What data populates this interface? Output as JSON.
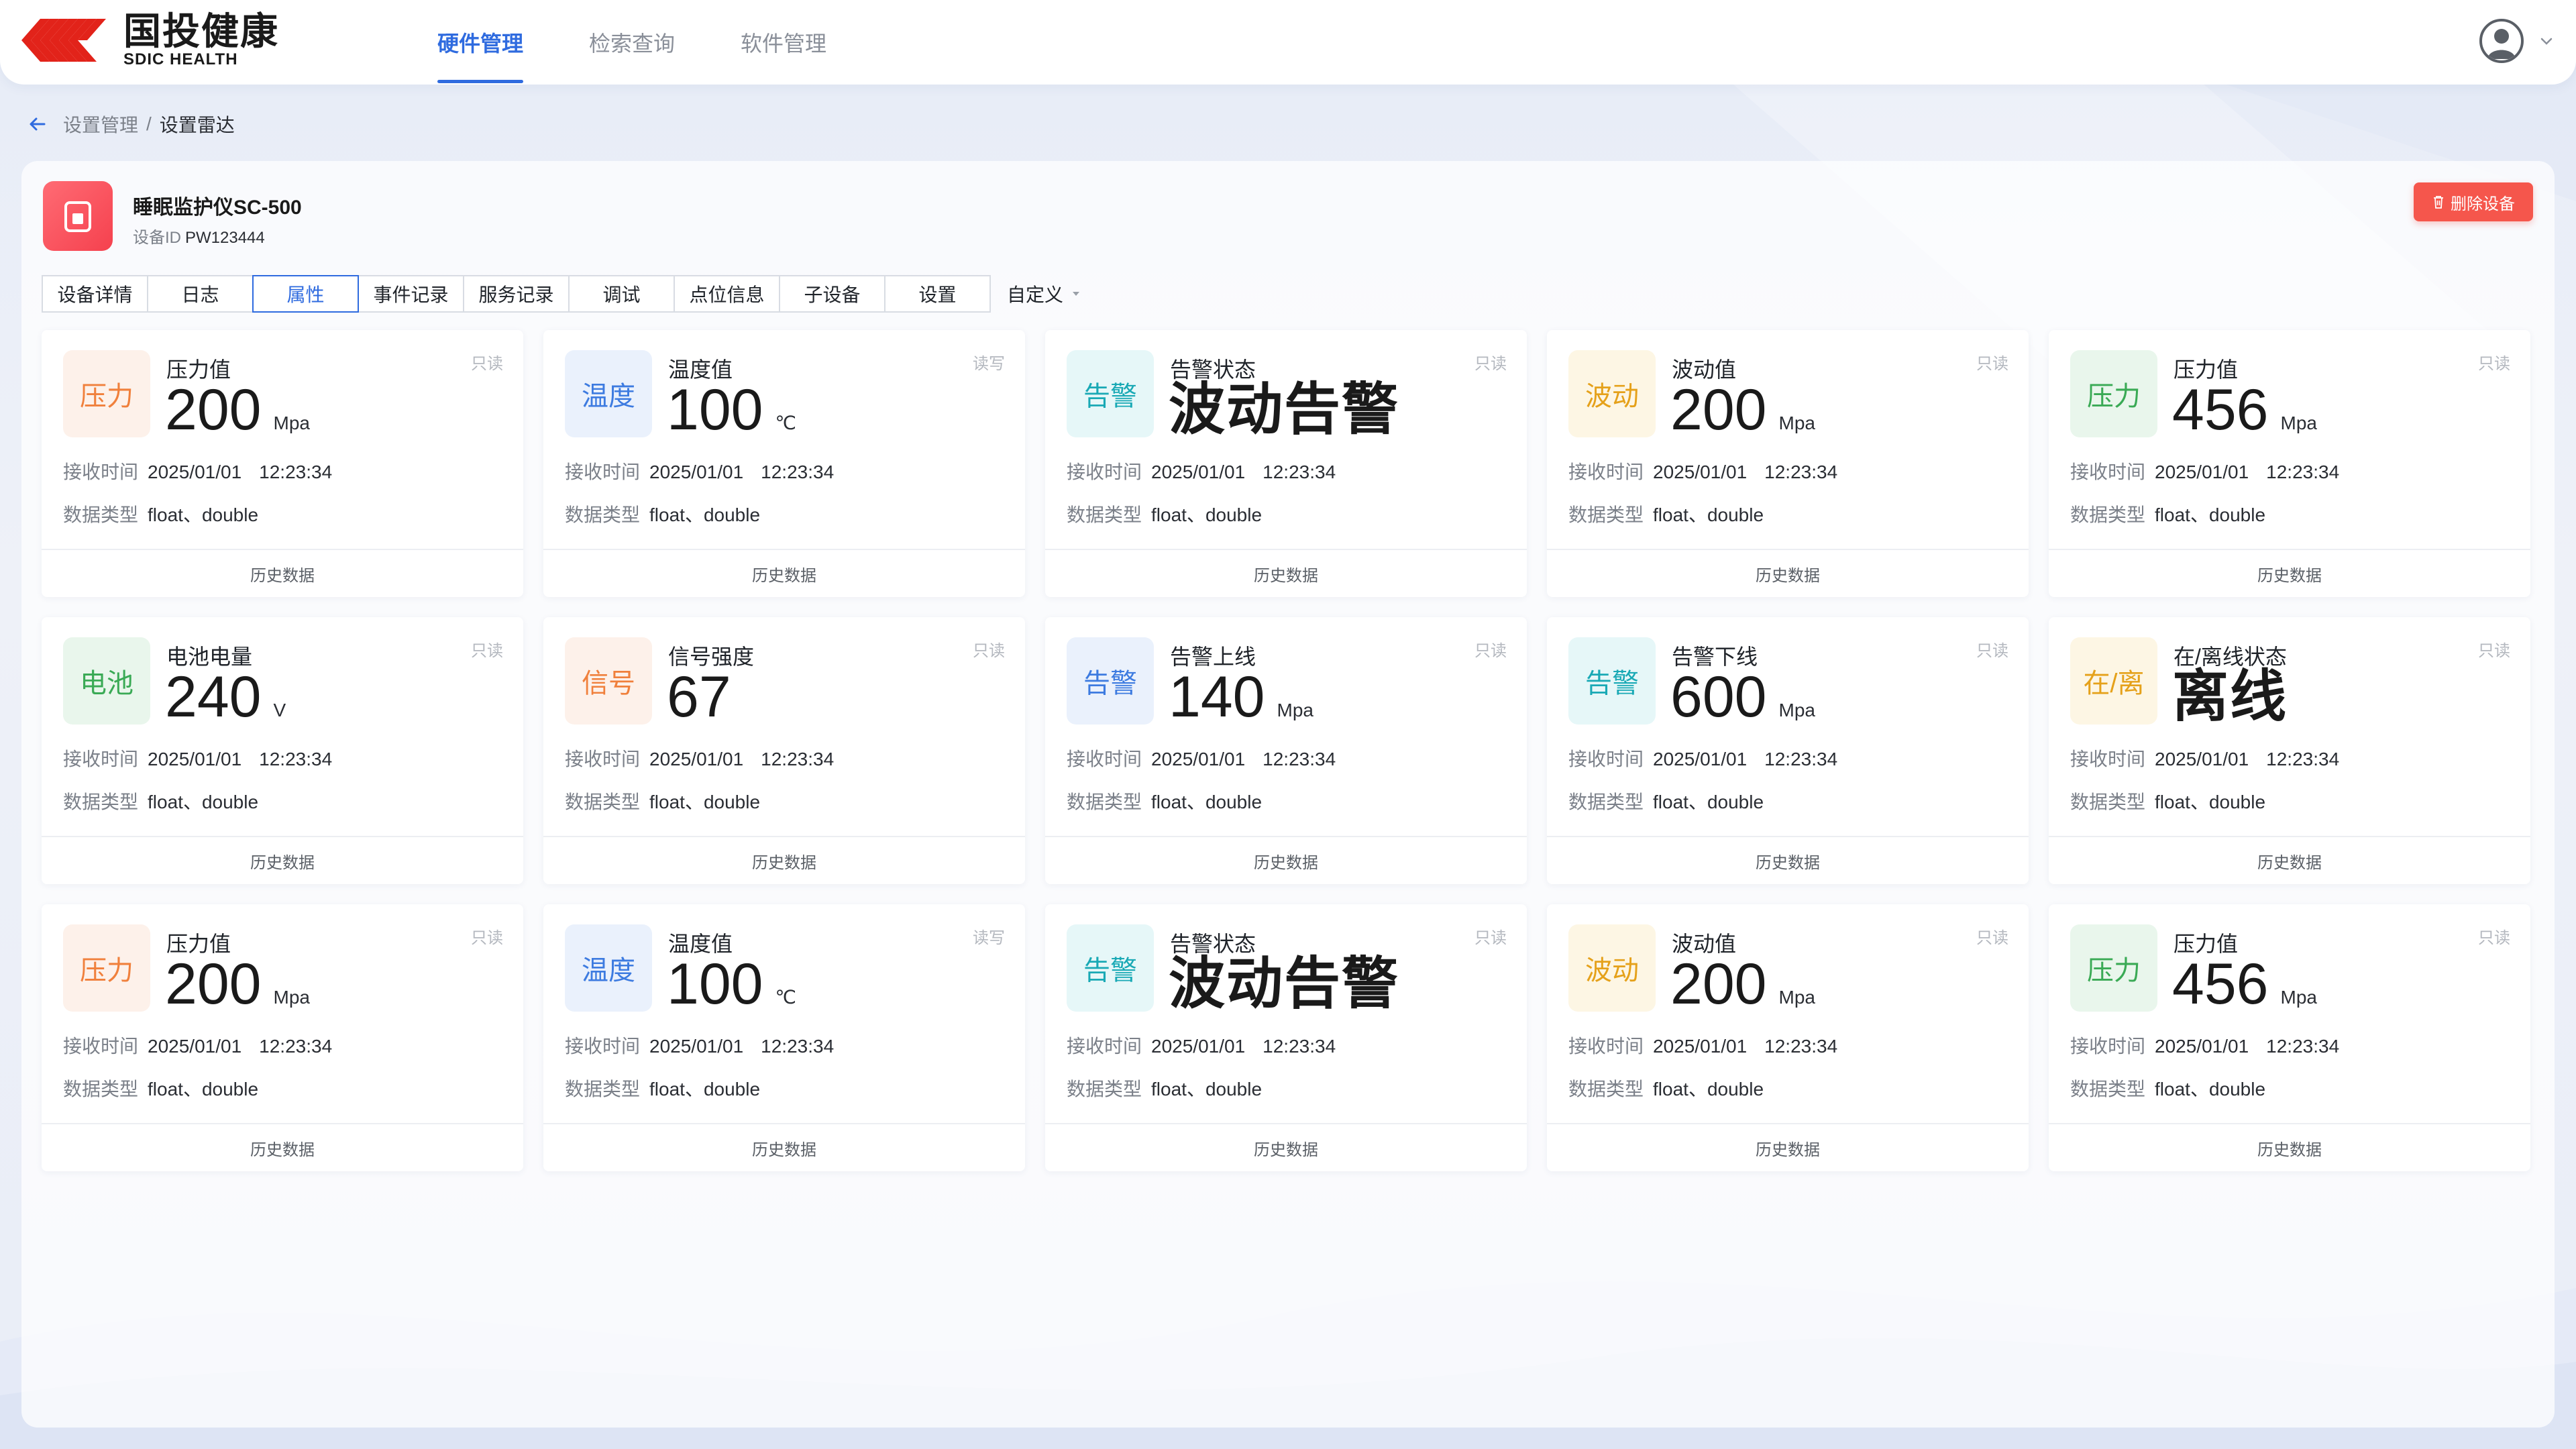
{
  "app": {
    "logo_cn": "国投健康",
    "logo_en": "SDIC HEALTH",
    "nav": [
      {
        "label": "硬件管理",
        "active": true
      },
      {
        "label": "检索查询",
        "active": false
      },
      {
        "label": "软件管理",
        "active": false
      }
    ]
  },
  "breadcrumb": {
    "parent": "设置管理",
    "separator": "/",
    "current": "设置雷达"
  },
  "device": {
    "name": "睡眠监护仪SC-500",
    "id_label": "设备ID",
    "id_value": "PW123444",
    "delete_label": "删除设备"
  },
  "tabs": [
    {
      "label": "设备详情",
      "active": false
    },
    {
      "label": "日志",
      "active": false
    },
    {
      "label": "属性",
      "active": true
    },
    {
      "label": "事件记录",
      "active": false
    },
    {
      "label": "服务记录",
      "active": false
    },
    {
      "label": "调试",
      "active": false
    },
    {
      "label": "点位信息",
      "active": false
    },
    {
      "label": "子设备",
      "active": false
    },
    {
      "label": "设置",
      "active": false
    }
  ],
  "custom_tab": "自定义",
  "card_labels": {
    "time_key": "接收时间",
    "type_key": "数据类型",
    "footer": "历史数据"
  },
  "cards": [
    {
      "badge": "压力",
      "color": "#f0803c",
      "bg": "#fdf1ea",
      "title": "压力值",
      "value": "200",
      "unit": "Mpa",
      "text_value": false,
      "rw": "只读",
      "date": "2025/01/01",
      "time": "12:23:34",
      "dtype": "float、double"
    },
    {
      "badge": "温度",
      "color": "#3d7be0",
      "bg": "#eaf1fc",
      "title": "温度值",
      "value": "100",
      "unit": "℃",
      "text_value": false,
      "rw": "读写",
      "date": "2025/01/01",
      "time": "12:23:34",
      "dtype": "float、double"
    },
    {
      "badge": "告警",
      "color": "#19a9b5",
      "bg": "#e6f7f8",
      "title": "告警状态",
      "value": "波动告警",
      "unit": "",
      "text_value": true,
      "rw": "只读",
      "date": "2025/01/01",
      "time": "12:23:34",
      "dtype": "float、double"
    },
    {
      "badge": "波动",
      "color": "#e5a11a",
      "bg": "#fdf6e4",
      "title": "波动值",
      "value": "200",
      "unit": "Mpa",
      "text_value": false,
      "rw": "只读",
      "date": "2025/01/01",
      "time": "12:23:34",
      "dtype": "float、double"
    },
    {
      "badge": "压力",
      "color": "#3aaa55",
      "bg": "#e9f6ec",
      "title": "压力值",
      "value": "456",
      "unit": "Mpa",
      "text_value": false,
      "rw": "只读",
      "date": "2025/01/01",
      "time": "12:23:34",
      "dtype": "float、double"
    },
    {
      "badge": "电池",
      "color": "#3aaa55",
      "bg": "#e9f6ec",
      "title": "电池电量",
      "value": "240",
      "unit": "V",
      "text_value": false,
      "rw": "只读",
      "date": "2025/01/01",
      "time": "12:23:34",
      "dtype": "float、double"
    },
    {
      "badge": "信号",
      "color": "#f0803c",
      "bg": "#fdf1ea",
      "title": "信号强度",
      "value": "67",
      "unit": "",
      "text_value": false,
      "rw": "只读",
      "date": "2025/01/01",
      "time": "12:23:34",
      "dtype": "float、double"
    },
    {
      "badge": "告警",
      "color": "#3d7be0",
      "bg": "#eaf1fc",
      "title": "告警上线",
      "value": "140",
      "unit": "Mpa",
      "text_value": false,
      "rw": "只读",
      "date": "2025/01/01",
      "time": "12:23:34",
      "dtype": "float、double"
    },
    {
      "badge": "告警",
      "color": "#19a9b5",
      "bg": "#e6f7f8",
      "title": "告警下线",
      "value": "600",
      "unit": "Mpa",
      "text_value": false,
      "rw": "只读",
      "date": "2025/01/01",
      "time": "12:23:34",
      "dtype": "float、double"
    },
    {
      "badge": "在/离",
      "color": "#e5a11a",
      "bg": "#fdf6e4",
      "title": "在/离线状态",
      "value": "离线",
      "unit": "",
      "text_value": true,
      "rw": "只读",
      "date": "2025/01/01",
      "time": "12:23:34",
      "dtype": "float、double"
    },
    {
      "badge": "压力",
      "color": "#f0803c",
      "bg": "#fdf1ea",
      "title": "压力值",
      "value": "200",
      "unit": "Mpa",
      "text_value": false,
      "rw": "只读",
      "date": "2025/01/01",
      "time": "12:23:34",
      "dtype": "float、double"
    },
    {
      "badge": "温度",
      "color": "#3d7be0",
      "bg": "#eaf1fc",
      "title": "温度值",
      "value": "100",
      "unit": "℃",
      "text_value": false,
      "rw": "读写",
      "date": "2025/01/01",
      "time": "12:23:34",
      "dtype": "float、double"
    },
    {
      "badge": "告警",
      "color": "#19a9b5",
      "bg": "#e6f7f8",
      "title": "告警状态",
      "value": "波动告警",
      "unit": "",
      "text_value": true,
      "rw": "只读",
      "date": "2025/01/01",
      "time": "12:23:34",
      "dtype": "float、double"
    },
    {
      "badge": "波动",
      "color": "#e5a11a",
      "bg": "#fdf6e4",
      "title": "波动值",
      "value": "200",
      "unit": "Mpa",
      "text_value": false,
      "rw": "只读",
      "date": "2025/01/01",
      "time": "12:23:34",
      "dtype": "float、double"
    },
    {
      "badge": "压力",
      "color": "#3aaa55",
      "bg": "#e9f6ec",
      "title": "压力值",
      "value": "456",
      "unit": "Mpa",
      "text_value": false,
      "rw": "只读",
      "date": "2025/01/01",
      "time": "12:23:34",
      "dtype": "float、double"
    }
  ]
}
